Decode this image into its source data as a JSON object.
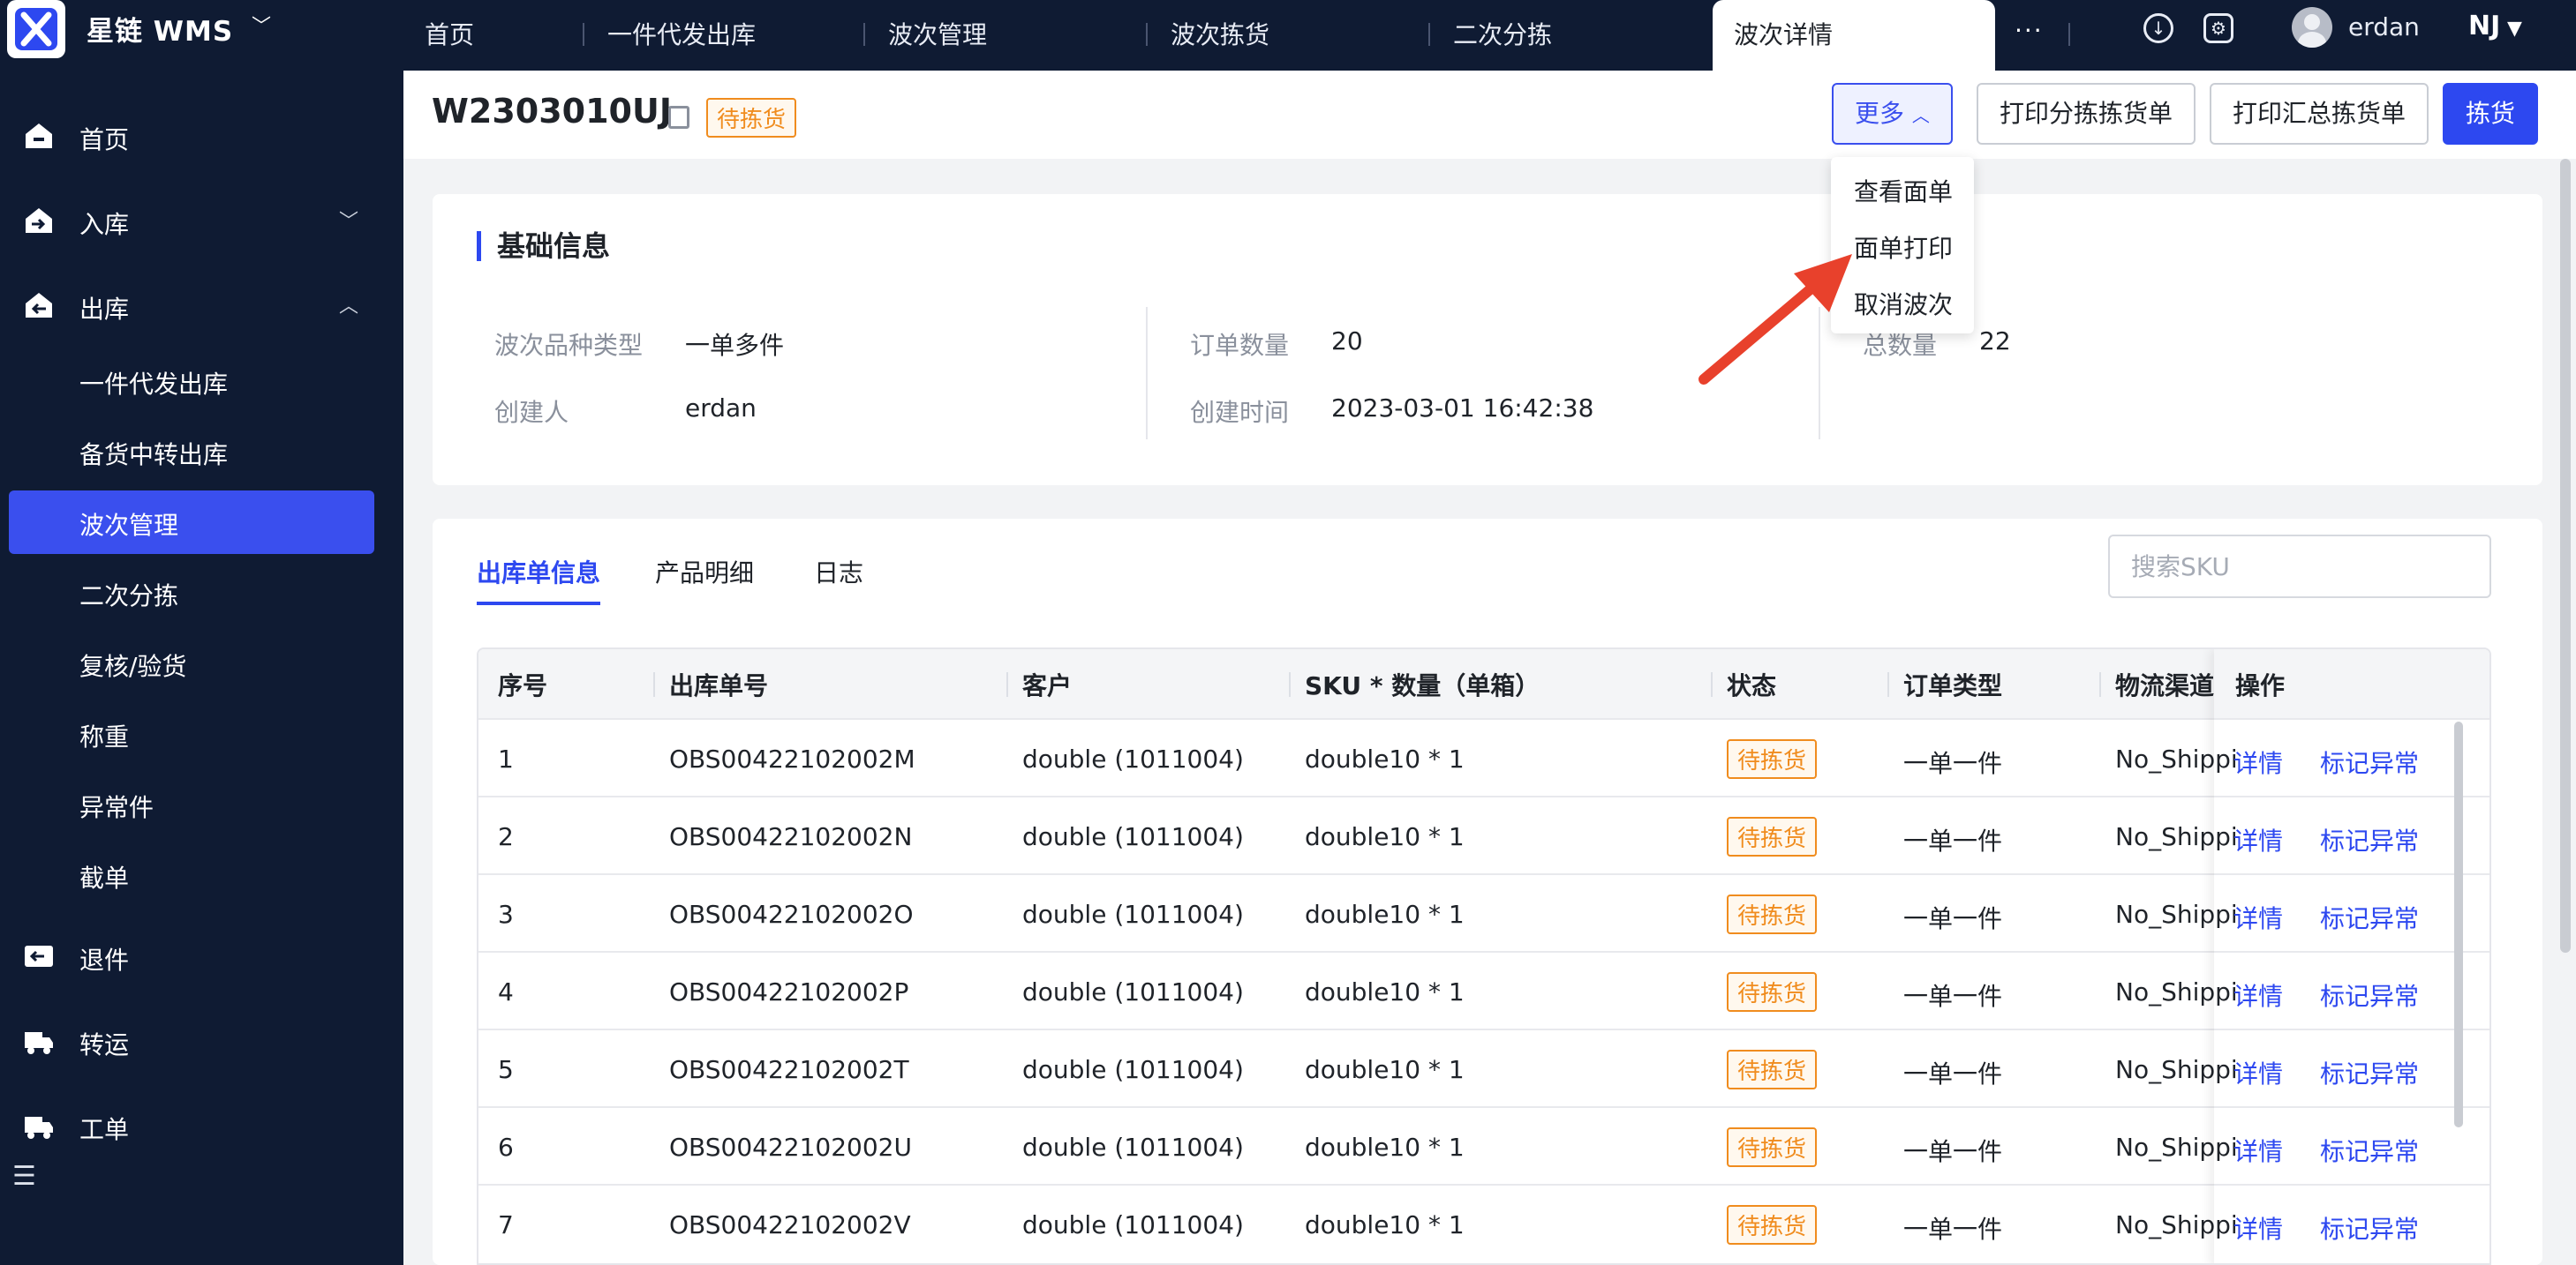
{
  "app": {
    "title": "星链  WMS"
  },
  "top_tabs": [
    {
      "label": "首页"
    },
    {
      "label": "一件代发出库"
    },
    {
      "label": "波次管理"
    },
    {
      "label": "波次拣货"
    },
    {
      "label": "二次分拣"
    },
    {
      "label": "波次详情"
    }
  ],
  "top_tab_more": "···",
  "user": {
    "name": "erdan",
    "lang": "NJ"
  },
  "sidebar": {
    "menu": [
      {
        "label": "首页",
        "icon": "home-icon"
      },
      {
        "label": "入库",
        "icon": "inbound-icon",
        "arrow": "﹀"
      },
      {
        "label": "出库",
        "icon": "outbound-icon",
        "arrow": "︿"
      },
      {
        "label": "退件",
        "icon": "return-icon"
      },
      {
        "label": "转运",
        "icon": "truck-icon"
      },
      {
        "label": "工单",
        "icon": "work-order-icon"
      }
    ],
    "outbound_sub": [
      {
        "label": "一件代发出库"
      },
      {
        "label": "备货中转出库"
      },
      {
        "label": "波次管理"
      },
      {
        "label": "二次分拣"
      },
      {
        "label": "复核/验货"
      },
      {
        "label": "称重"
      },
      {
        "label": "异常件"
      },
      {
        "label": "截单"
      }
    ]
  },
  "header": {
    "wave_id": "W2303010UJ",
    "status": "待拣货",
    "buttons": {
      "more": "更多",
      "print_sort": "打印分拣拣货单",
      "print_summary": "打印汇总拣货单",
      "pick": "拣货"
    }
  },
  "more_menu": [
    {
      "label": "查看面单"
    },
    {
      "label": "面单打印"
    },
    {
      "label": "取消波次"
    }
  ],
  "basic_info": {
    "title": "基础信息",
    "fields": [
      {
        "label": "波次品种类型",
        "value": "一单多件"
      },
      {
        "label": "订单数量",
        "value": "20"
      },
      {
        "label": "总数量",
        "value": "22"
      },
      {
        "label": "创建人",
        "value": "erdan"
      },
      {
        "label": "创建时间",
        "value": "2023-03-01 16:42:38"
      }
    ]
  },
  "list": {
    "tabs": [
      {
        "label": "出库单信息"
      },
      {
        "label": "产品明细"
      },
      {
        "label": "日志"
      }
    ],
    "search_placeholder": "搜索SKU",
    "columns": [
      "序号",
      "出库单号",
      "客户",
      "SKU * 数量（单箱）",
      "状态",
      "订单类型",
      "物流渠道",
      "操作"
    ],
    "rows": [
      {
        "no": "1",
        "order": "OBS00422102002M",
        "customer": "double (1011004)",
        "sku": "double10 * 1",
        "status": "待拣货",
        "type": "一单一件",
        "channel": "No_Shipping",
        "op1": "详情",
        "op2": "标记异常"
      },
      {
        "no": "2",
        "order": "OBS00422102002N",
        "customer": "double (1011004)",
        "sku": "double10 * 1",
        "status": "待拣货",
        "type": "一单一件",
        "channel": "No_Shipping",
        "op1": "详情",
        "op2": "标记异常"
      },
      {
        "no": "3",
        "order": "OBS00422102002O",
        "customer": "double (1011004)",
        "sku": "double10 * 1",
        "status": "待拣货",
        "type": "一单一件",
        "channel": "No_Shipping",
        "op1": "详情",
        "op2": "标记异常"
      },
      {
        "no": "4",
        "order": "OBS00422102002P",
        "customer": "double (1011004)",
        "sku": "double10 * 1",
        "status": "待拣货",
        "type": "一单一件",
        "channel": "No_Shipping",
        "op1": "详情",
        "op2": "标记异常"
      },
      {
        "no": "5",
        "order": "OBS00422102002T",
        "customer": "double (1011004)",
        "sku": "double10 * 1",
        "status": "待拣货",
        "type": "一单一件",
        "channel": "No_Shipping",
        "op1": "详情",
        "op2": "标记异常"
      },
      {
        "no": "6",
        "order": "OBS00422102002U",
        "customer": "double (1011004)",
        "sku": "double10 * 1",
        "status": "待拣货",
        "type": "一单一件",
        "channel": "No_Shipping",
        "op1": "详情",
        "op2": "标记异常"
      },
      {
        "no": "7",
        "order": "OBS00422102002V",
        "customer": "double (1011004)",
        "sku": "double10 * 1",
        "status": "待拣货",
        "type": "一单一件",
        "channel": "No_Shipping",
        "op1": "详情",
        "op2": "标记异常"
      }
    ]
  },
  "colors": {
    "sidebar_bg": "#0f1b33",
    "accent": "#2d48f0",
    "warning": "#f08c1e",
    "annotation_arrow": "#e8412c"
  }
}
